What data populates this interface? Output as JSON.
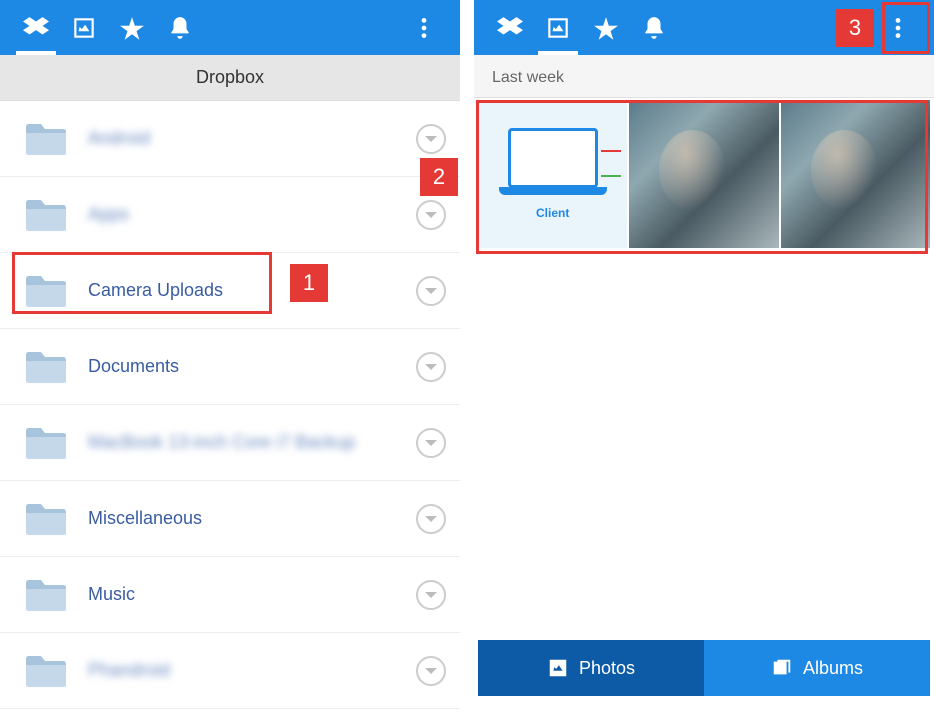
{
  "callouts": {
    "one": "1",
    "two": "2",
    "three": "3"
  },
  "left": {
    "title": "Dropbox",
    "files": [
      {
        "name": "Android",
        "blurred": true
      },
      {
        "name": "Apps",
        "blurred": true
      },
      {
        "name": "Camera Uploads",
        "blurred": false
      },
      {
        "name": "Documents",
        "blurred": false
      },
      {
        "name": "MacBook 13-inch Core i7 Backup",
        "blurred": true
      },
      {
        "name": "Miscellaneous",
        "blurred": false
      },
      {
        "name": "Music",
        "blurred": false
      },
      {
        "name": "Phandroid",
        "blurred": true
      }
    ]
  },
  "right": {
    "section": "Last week",
    "client_label": "Client",
    "tabs": {
      "photos": "Photos",
      "albums": "Albums"
    }
  }
}
